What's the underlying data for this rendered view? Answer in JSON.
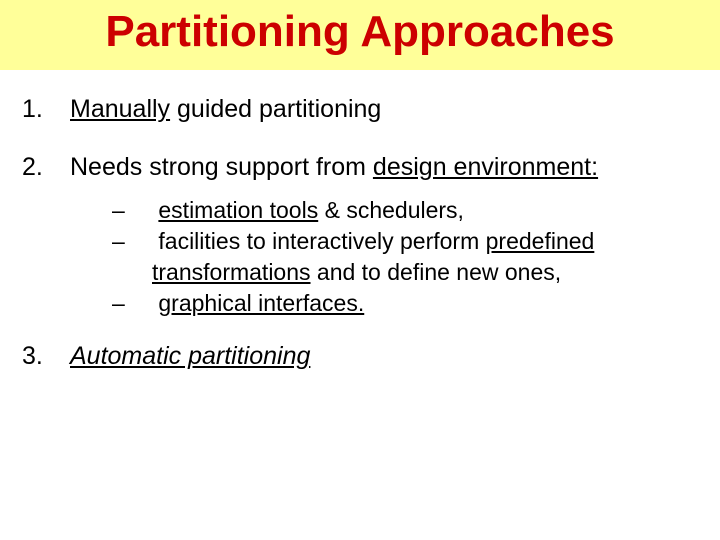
{
  "title": "Partitioning Approaches",
  "items": {
    "n1": "1.",
    "t1": "Manually guided partitioning",
    "n2": "2.",
    "t2a": "Needs strong support from ",
    "t2b": "design environment:",
    "n3": "3.",
    "t3": "Automatic partitioning"
  },
  "subs": {
    "dash": "–",
    "s1a": "estimation tools",
    "s1b": " & schedulers,",
    "s2a": "facilities to interactively perform ",
    "s2b": "predefined transformations",
    "s2c": " and to define new ones,",
    "s3a": "graphical interfaces."
  }
}
